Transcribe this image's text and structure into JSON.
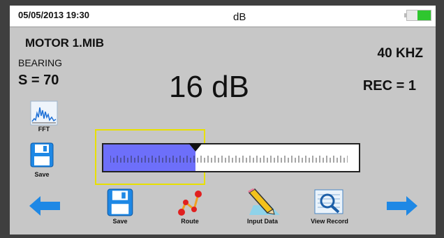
{
  "status_bar": {
    "datetime": "05/05/2013 19:30",
    "title": "dB",
    "battery_level": 0.55,
    "battery_color": "#2fc62f"
  },
  "file_name": "MOTOR 1.MIB",
  "sensor_type": "BEARING",
  "sensitivity": "S = 70",
  "frequency": "40 KHZ",
  "reading": "16 dB",
  "record": "REC = 1",
  "meter": {
    "level": 0.36,
    "fill_color": "#6d6ffa"
  },
  "fft_button": {
    "label": "FFT",
    "icon": "fft-spectrum-icon"
  },
  "save_button_left": {
    "label": "Save",
    "icon": "floppy-disk-icon"
  },
  "toolbar": {
    "back_icon": "arrow-left-icon",
    "forward_icon": "arrow-right-icon",
    "items": [
      {
        "label": "Save",
        "icon": "floppy-disk-icon"
      },
      {
        "label": "Route",
        "icon": "route-icon"
      },
      {
        "label": "Input Data",
        "icon": "pencil-icon"
      },
      {
        "label": "View Record",
        "icon": "magnifier-record-icon"
      }
    ]
  }
}
